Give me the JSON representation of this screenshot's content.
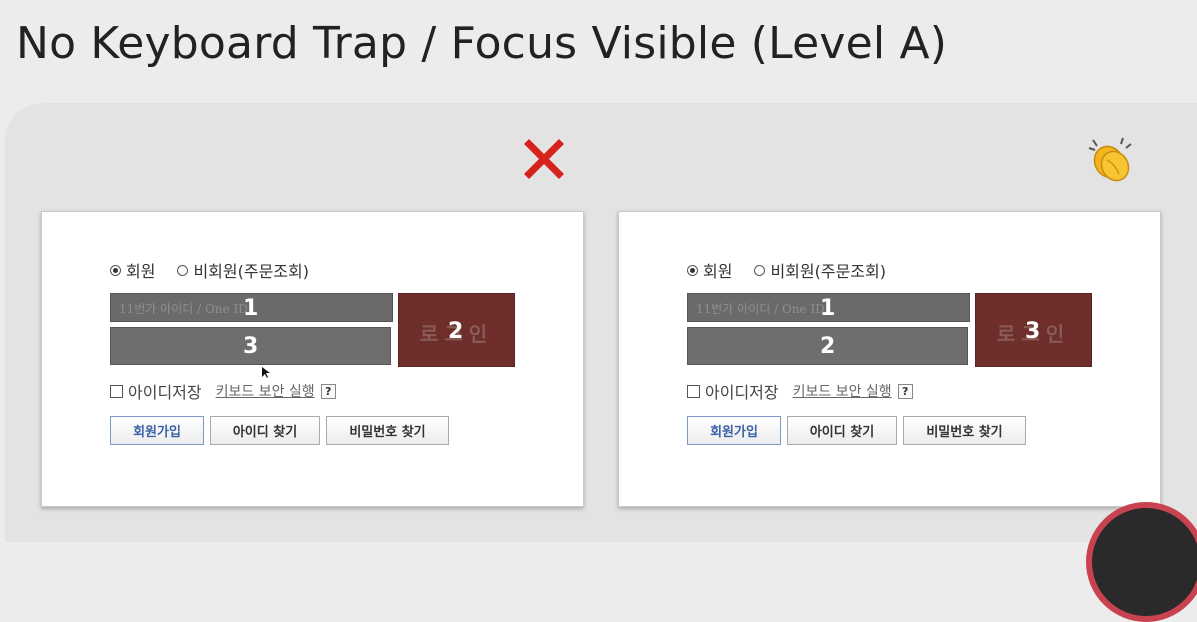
{
  "slide": {
    "title": "No Keyboard Trap / Focus Visible (Level A)"
  },
  "icons": {
    "bad": "red-x-icon",
    "good": "clapping-hands-icon"
  },
  "colors": {
    "bad_mark": "#d6221c",
    "login_bg": "#6e2e2b",
    "field_bg": "#6a6a6a",
    "primary_link": "#3b62a6"
  },
  "panels": [
    {
      "id": "bad",
      "radio_member": "회원",
      "radio_guest": "비회원(주문조회)",
      "id_placeholder": "11번가 아이디 / One ID",
      "login_label": "로그인",
      "order_id": "1",
      "order_login": "2",
      "order_pw": "3",
      "save_id": "아이디저장",
      "keyboard_security": "키보드 보안 실행",
      "help": "?",
      "btn_signup": "회원가입",
      "btn_find_id": "아이디 찾기",
      "btn_find_pw": "비밀번호 찾기"
    },
    {
      "id": "good",
      "radio_member": "회원",
      "radio_guest": "비회원(주문조회)",
      "id_placeholder": "11번가 아이디 / One ID",
      "login_label": "로그인",
      "order_id": "1",
      "order_pw": "2",
      "order_login": "3",
      "save_id": "아이디저장",
      "keyboard_security": "키보드 보안 실행",
      "help": "?",
      "btn_signup": "회원가입",
      "btn_find_id": "아이디 찾기",
      "btn_find_pw": "비밀번호 찾기"
    }
  ]
}
